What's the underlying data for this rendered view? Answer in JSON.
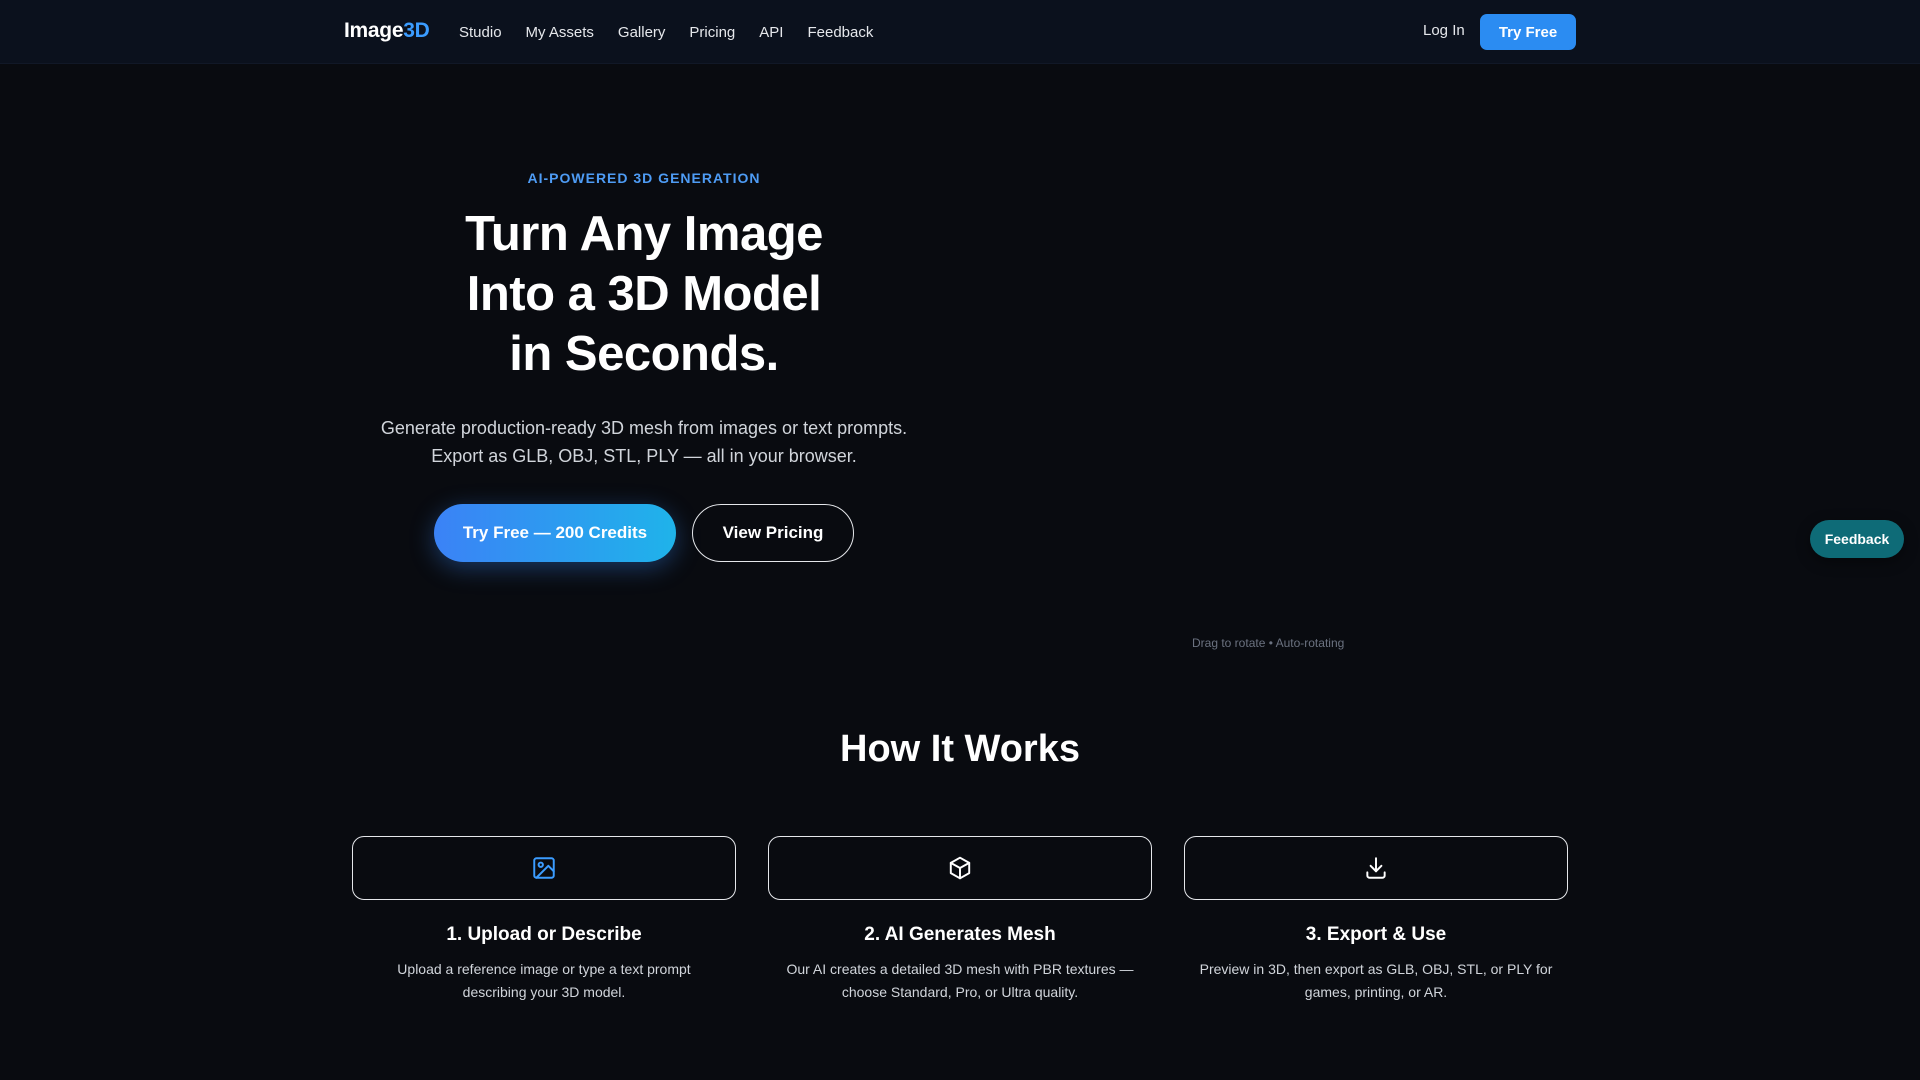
{
  "nav": {
    "brand_main": "Image",
    "brand_accent": "3D",
    "links": [
      "Studio",
      "My Assets",
      "Gallery",
      "Pricing",
      "API",
      "Feedback"
    ],
    "login": "Log In",
    "try_free": "Try Free"
  },
  "hero": {
    "eyebrow": "AI-POWERED 3D GENERATION",
    "headline_lines": [
      "Turn Any Image",
      "Into a 3D Model",
      "in Seconds."
    ],
    "subtext_lines": [
      "Generate production-ready 3D mesh from images or text prompts.",
      "Export as GLB, OBJ, STL, PLY — all in your browser."
    ],
    "primary_cta": "Try Free — 200 Credits",
    "secondary_cta": "View Pricing"
  },
  "viewer": {
    "hint": "Drag to rotate • Auto-rotating"
  },
  "floating_feedback": "Feedback",
  "how_it_works": {
    "title": "How It Works",
    "steps": [
      {
        "icon": "image-icon",
        "title": "1. Upload or Describe",
        "desc_lines": [
          "Upload a reference image or type a text prompt",
          "describing your 3D model."
        ]
      },
      {
        "icon": "cube-icon",
        "title": "2. AI Generates Mesh",
        "desc_lines": [
          "Our AI creates a detailed 3D mesh with PBR textures —",
          "choose Standard, Pro, or Ultra quality."
        ]
      },
      {
        "icon": "download-icon",
        "title": "3. Export & Use",
        "desc_lines": [
          "Preview in 3D, then export as GLB, OBJ, STL, or PLY for",
          "games, printing, or AR."
        ]
      }
    ]
  },
  "colors": {
    "background": "#090b10",
    "nav_background": "#0b111d",
    "accent_blue": "#2b8cf2",
    "eyebrow_blue": "#4e9cf5",
    "feedback_teal": "#0e6b77"
  }
}
